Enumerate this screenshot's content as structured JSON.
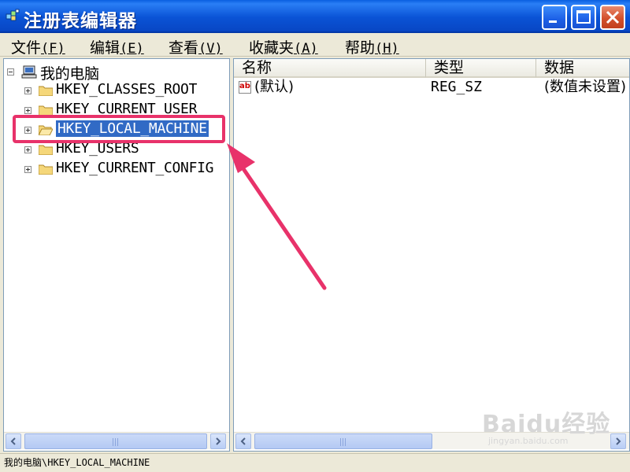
{
  "window": {
    "title": "注册表编辑器",
    "buttons": [
      "minimize",
      "maximize",
      "close"
    ]
  },
  "menu": [
    {
      "label": "文件",
      "key": "(F)"
    },
    {
      "label": "编辑",
      "key": "(E)"
    },
    {
      "label": "查看",
      "key": "(V)"
    },
    {
      "label": "收藏夹",
      "key": "(A)"
    },
    {
      "label": "帮助",
      "key": "(H)"
    }
  ],
  "tree": {
    "root": {
      "label": "我的电脑",
      "icon": "computer-icon",
      "expanded": true
    },
    "keys": [
      {
        "label": "HKEY_CLASSES_ROOT",
        "selected": false
      },
      {
        "label": "HKEY_CURRENT_USER",
        "selected": false
      },
      {
        "label": "HKEY_LOCAL_MACHINE",
        "selected": true
      },
      {
        "label": "HKEY_USERS",
        "selected": false
      },
      {
        "label": "HKEY_CURRENT_CONFIG",
        "selected": false
      }
    ]
  },
  "list": {
    "columns": [
      "名称",
      "类型",
      "数据"
    ],
    "rows": [
      {
        "name": "(默认)",
        "type": "REG_SZ",
        "data": "(数值未设置)",
        "icon": "string-value-icon"
      }
    ]
  },
  "status": {
    "path": "我的电脑\\HKEY_LOCAL_MACHINE"
  },
  "colors": {
    "titlebar": "#0a53d6",
    "selection": "#316ac5",
    "annotation": "#e8326a"
  },
  "watermark": {
    "brand": "Baidu经验",
    "url": "jingyan.baidu.com"
  }
}
